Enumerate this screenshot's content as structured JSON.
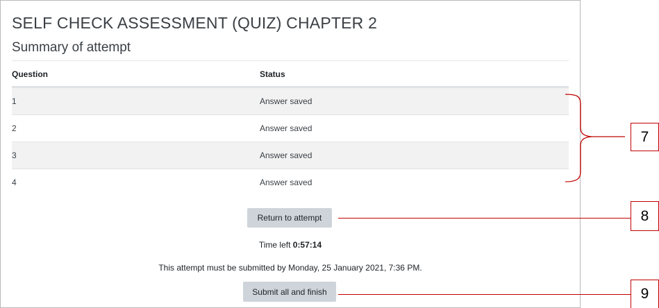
{
  "quiz": {
    "title": "SELF CHECK ASSESSMENT (QUIZ) CHAPTER 2",
    "subtitle": "Summary of attempt"
  },
  "table": {
    "headers": {
      "question": "Question",
      "status": "Status"
    },
    "rows": [
      {
        "question": "1",
        "status": "Answer saved"
      },
      {
        "question": "2",
        "status": "Answer saved"
      },
      {
        "question": "3",
        "status": "Answer saved"
      },
      {
        "question": "4",
        "status": "Answer saved"
      }
    ]
  },
  "actions": {
    "return_label": "Return to attempt",
    "submit_label": "Submit all and finish"
  },
  "timer": {
    "label": "Time left",
    "value": "0:57:14"
  },
  "deadline_text": "This attempt must be submitted by Monday, 25 January 2021, 7:36 PM.",
  "annotations": {
    "rows_callout": "7",
    "return_callout": "8",
    "submit_callout": "9",
    "color": "#c00000"
  }
}
